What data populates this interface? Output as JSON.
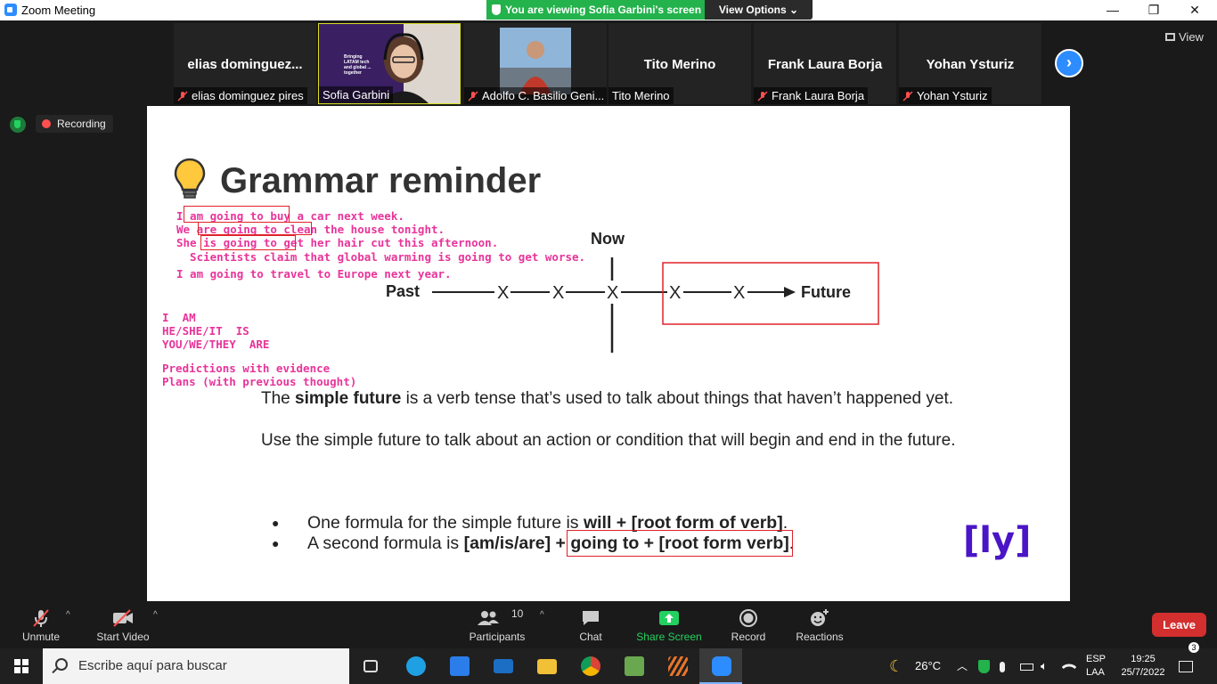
{
  "window": {
    "title": "Zoom Meeting",
    "share_banner": "You are viewing Sofia Garbini's screen",
    "view_options": "View Options",
    "minimize": "—",
    "restore": "❐",
    "close": "✕"
  },
  "strip": {
    "view_label": "View",
    "next_icon": "›",
    "tiles": [
      {
        "big_name": "elias  dominguez...",
        "label": "elias dominguez pires",
        "muted": true
      },
      {
        "label": "Sofia Garbini",
        "muted": false,
        "video": true,
        "shirt_text": "Bringing LATAM tech and global ... together"
      },
      {
        "label": "Adolfo C. Basilio Geni...",
        "muted": true,
        "video": true
      },
      {
        "big_name": "Tito Merino",
        "label": "Tito Merino",
        "muted": false
      },
      {
        "big_name": "Frank Laura Borja",
        "label": "Frank Laura Borja",
        "muted": true
      },
      {
        "big_name": "Yohan Ysturiz",
        "label": "Yohan Ysturiz",
        "muted": true
      }
    ]
  },
  "recording": {
    "label": "Recording"
  },
  "slide": {
    "title": "Grammar reminder",
    "examples": [
      "I am going to buy a car next week.",
      "We are going to clean the house tonight.",
      "She is going to get her hair cut this afternoon.",
      "  Scientists claim that global warming is going to get worse.",
      "I am going to travel to Europe next year."
    ],
    "conjugation": [
      "I  AM",
      "HE/SHE/IT  IS",
      "YOU/WE/THEY  ARE"
    ],
    "uses": [
      "Predictions with evidence",
      "Plans (with previous thought)"
    ],
    "timeline": {
      "past": "Past",
      "now": "Now",
      "future": "Future",
      "mark": "X"
    },
    "paragraph1_pre": "The ",
    "paragraph1_bold": "simple future",
    "paragraph1_post": " is a verb tense that’s used to talk about things that haven’t happened yet.",
    "paragraph2": "Use the simple future to talk about an action or condition that will begin and end in the future.",
    "bullet1_pre": "One formula for the simple future is ",
    "bullet1_bold": "will + [root form of verb]",
    "bullet1_post": ".",
    "bullet2_pre": "A second formula is ",
    "bullet2_bold1": "[am/is/are] + ",
    "bullet2_bold2": "going to + [root form verb]",
    "bullet2_post": ".",
    "bullet_dot": "●",
    "logo": "[ly]"
  },
  "controls": {
    "unmute": "Unmute",
    "start_video": "Start Video",
    "participants": "Participants",
    "participants_count": "10",
    "chat": "Chat",
    "share_screen": "Share Screen",
    "record": "Record",
    "reactions": "Reactions",
    "leave": "Leave",
    "caret": "^"
  },
  "taskbar": {
    "search_placeholder": "Escribe aquí para buscar",
    "temperature": "26°C",
    "lang1": "ESP",
    "lang2": "LAA",
    "time": "19:25",
    "date": "25/7/2022",
    "notifications": "3"
  },
  "colors": {
    "zoom_blue": "#2d8cff",
    "share_green": "#23b24b",
    "annotation_pink": "#e8349a",
    "annotation_red": "#e0222a",
    "leave_red": "#d32f2f",
    "logo_purple": "#4a15c7"
  }
}
